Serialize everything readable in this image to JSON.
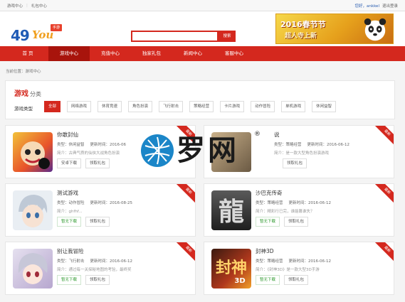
{
  "topbar": {
    "links": [
      "游戏中心",
      "礼包中心"
    ],
    "user": "您好，ankkel",
    "logout": "退出登录"
  },
  "logo": {
    "number": "49",
    "word": "You",
    "tag": "手游"
  },
  "search": {
    "placeholder": "",
    "button": "搜索"
  },
  "banner": {
    "title": "2016春节节",
    "subtitle": "超人寺上新"
  },
  "nav": {
    "items": [
      "首 页",
      "游戏中心",
      "充值中心",
      "独家礼包",
      "新闻中心",
      "客服中心"
    ],
    "active": 1
  },
  "breadcrumb": {
    "text": "当前位置：游戏中心"
  },
  "category": {
    "title": "游戏",
    "title_suffix": "分类",
    "type_label": "游戏类型",
    "tags": [
      "全部",
      "网络游戏",
      "休育竞速",
      "角色扮演",
      "飞行射击",
      "策略经营",
      "卡片游戏",
      "动作冒险",
      "单机游戏",
      "休闲益智"
    ],
    "active_tag": 0
  },
  "cards": [
    {
      "name": "你敢封仙",
      "type": "类型：休闲益智",
      "updated": "更新时间：2016-06",
      "desc": "简介：古典气质的仙侠大战角色扮演",
      "btn1": "安卓下载",
      "btn2": "领取礼包",
      "ribbon": "最新"
    },
    {
      "name": "说",
      "type": "类型：策略经营",
      "updated": "更新时间：2016-06-12",
      "desc": "简介：是一款大型角色扮演游戏",
      "btn1": "领取礼包",
      "btn2": "",
      "ribbon": "最新"
    },
    {
      "name": "测试游戏",
      "type": "类型：动作冒险",
      "updated": "更新时间：2016-08-25",
      "desc": "简介：ghfhf...",
      "btn1": "暂无下载",
      "btn2": "领取礼包",
      "ribbon": "最新"
    },
    {
      "name": "沙巴克传奇",
      "type": "类型：策略经营",
      "updated": "更新时间：2016-06-12",
      "desc": "简介：精彩行已完，谁能篡谁失？",
      "btn1": "暂无下载",
      "btn2": "领取礼包",
      "ribbon": "最新"
    },
    {
      "name": "别让我冒险",
      "type": "类型：飞行射击",
      "updated": "更新时间：2016-06-12",
      "desc": "简介：通过每一关探秘地图的考验，最终奖",
      "btn1": "暂无下载",
      "btn2": "领取礼包",
      "ribbon": "最新"
    },
    {
      "name": "封神3D",
      "type": "类型：策略经营",
      "updated": "更新时间：2016-06-12",
      "desc": "简介：《封神3D》是一款大型3D手游",
      "btn1": "暂无下载",
      "btn2": "领取礼包",
      "ribbon": "最新"
    }
  ],
  "watermark": {
    "text": "罗网",
    "registered": "®"
  },
  "colors": {
    "brand_red": "#d4281e",
    "nav_active": "#a8140c",
    "logo_blue": "#1f5bb5",
    "logo_orange": "#f0a020"
  }
}
